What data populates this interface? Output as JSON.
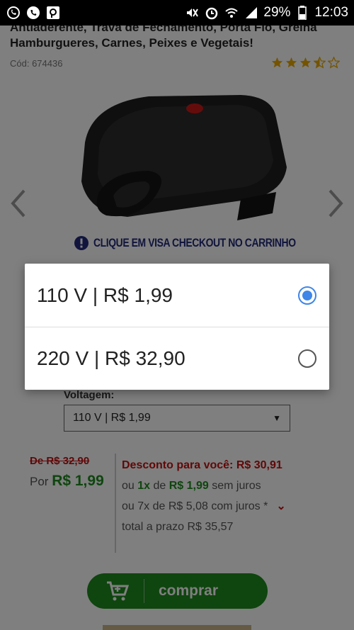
{
  "status_bar": {
    "battery": "29%",
    "time": "12:03"
  },
  "product": {
    "title": "Antiaderente, Trava de Fechamento, Porta Fio, Grelha Hamburgueres, Carnes, Peixes e Vegetais!",
    "code": "Cód: 674436",
    "rating_stars": 3.5
  },
  "banner": {
    "text": "CLIQUE EM VISA CHECKOUT NO CARRINHO"
  },
  "voltage": {
    "label": "Voltagem:",
    "selected": "110 V | R$ 1,99"
  },
  "price": {
    "old": "De R$ 32,90",
    "now_prefix": "Por",
    "now_value": "R$ 1,99",
    "discount_label": "Desconto para você:",
    "discount_value": "R$ 30,91",
    "line2_a": "ou",
    "line2_b": "1x",
    "line2_c": "de",
    "line2_d": "R$ 1,99",
    "line2_e": "sem juros",
    "installments": "ou 7x de R$ 5,08 com juros *",
    "total": "total a prazo R$ 35,57"
  },
  "buy_button": {
    "label": "comprar"
  },
  "dialog": {
    "options": [
      {
        "label": "110 V | R$ 1,99",
        "selected": true
      },
      {
        "label": "220 V | R$ 32,90",
        "selected": false
      }
    ]
  },
  "colors": {
    "accent": "#3e86e8",
    "price_green": "#1f8b1f",
    "discount_red": "#c21010",
    "banner_blue": "#222a7a"
  }
}
